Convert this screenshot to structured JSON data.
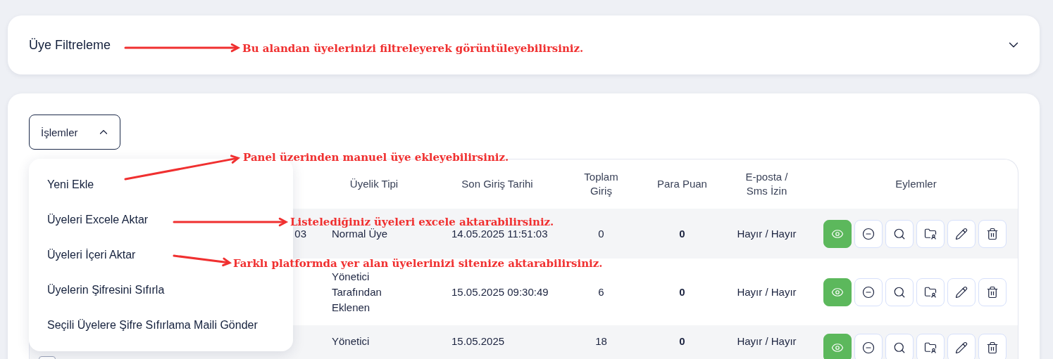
{
  "filter_panel": {
    "title": "Üye Filtreleme",
    "expanded": false
  },
  "actions_menu": {
    "label": "İşlemler",
    "expanded": true,
    "items": [
      {
        "label": "Yeni Ekle"
      },
      {
        "label": "Üyeleri Excele Aktar"
      },
      {
        "label": "Üyeleri İçeri Aktar"
      },
      {
        "label": "Üyelerin Şifresini Sıfırla"
      },
      {
        "label": "Seçili Üyelere Şifre Sıfırlama Maili Gönder"
      }
    ]
  },
  "table": {
    "columns": [
      "Üyelik Tipi",
      "Son Giriş Tarihi",
      "Toplam Giriş",
      "Para Puan",
      "E-posta / Sms İzin",
      "Eylemler"
    ],
    "rows": [
      {
        "registered": "03",
        "membership_type": "Normal Üye",
        "last_login": "14.05.2025 11:51:03",
        "total_logins": "0",
        "points": "0",
        "permissions": "Hayır / Hayır"
      },
      {
        "membership_type": "Yönetici Tarafından Eklenen",
        "last_login": "15.05.2025 09:30:49",
        "total_logins": "6",
        "points": "0",
        "permissions": "Hayır / Hayır"
      },
      {
        "checked": false,
        "membership_type": "Yönetici",
        "last_login": "15.05.2025",
        "total_logins": "18",
        "points": "0",
        "permissions": "Hayır / Hayır"
      }
    ]
  },
  "annotations": [
    {
      "text": "Bu alandan üyelerinizi filtreleyerek görüntüleyebilirsiniz."
    },
    {
      "text": "Panel üzerinden manuel üye ekleyebilirsiniz."
    },
    {
      "text": "Listelediğiniz üyeleri excele aktarabilirsiniz."
    },
    {
      "text": "Farklı platformda yer alan üyelerinizi sitenize aktarabilirsiniz."
    }
  ]
}
